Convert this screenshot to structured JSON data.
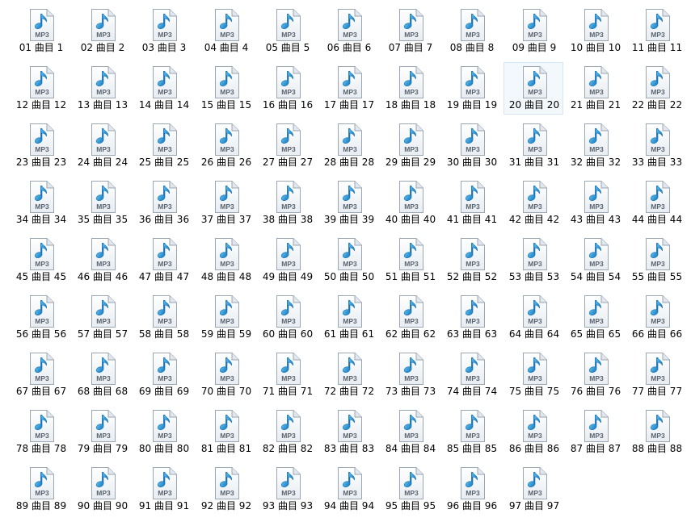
{
  "window": {
    "view": "large-icons",
    "selected_index": 19
  },
  "colors": {
    "page_bg": "#ffffff",
    "label_text": "#000000",
    "selection_bg": "#f3f8fd",
    "selection_border": "#d6e6f6",
    "note_color": "#1e86c8"
  },
  "file_icon": {
    "name": "mp3-file-icon",
    "badge_text": "MP3"
  },
  "files": [
    {
      "label": "01 曲目 1"
    },
    {
      "label": "02 曲目 2"
    },
    {
      "label": "03 曲目 3"
    },
    {
      "label": "04 曲目 4"
    },
    {
      "label": "05 曲目 5"
    },
    {
      "label": "06 曲目 6"
    },
    {
      "label": "07 曲目 7"
    },
    {
      "label": "08 曲目 8"
    },
    {
      "label": "09 曲目 9"
    },
    {
      "label": "10 曲目 10"
    },
    {
      "label": "11 曲目 11"
    },
    {
      "label": "12 曲目 12"
    },
    {
      "label": "13 曲目 13"
    },
    {
      "label": "14 曲目 14"
    },
    {
      "label": "15 曲目 15"
    },
    {
      "label": "16 曲目 16"
    },
    {
      "label": "17 曲目 17"
    },
    {
      "label": "18 曲目 18"
    },
    {
      "label": "19 曲目 19"
    },
    {
      "label": "20 曲目 20"
    },
    {
      "label": "21 曲目 21"
    },
    {
      "label": "22 曲目 22"
    },
    {
      "label": "23 曲目 23"
    },
    {
      "label": "24 曲目 24"
    },
    {
      "label": "25 曲目 25"
    },
    {
      "label": "26 曲目 26"
    },
    {
      "label": "27 曲目 27"
    },
    {
      "label": "28 曲目 28"
    },
    {
      "label": "29 曲目 29"
    },
    {
      "label": "30 曲目 30"
    },
    {
      "label": "31 曲目 31"
    },
    {
      "label": "32 曲目 32"
    },
    {
      "label": "33 曲目 33"
    },
    {
      "label": "34 曲目 34"
    },
    {
      "label": "35 曲目 35"
    },
    {
      "label": "36 曲目 36"
    },
    {
      "label": "37 曲目 37"
    },
    {
      "label": "38 曲目 38"
    },
    {
      "label": "39 曲目 39"
    },
    {
      "label": "40 曲目 40"
    },
    {
      "label": "41 曲目 41"
    },
    {
      "label": "42 曲目 42"
    },
    {
      "label": "43 曲目 43"
    },
    {
      "label": "44 曲目 44"
    },
    {
      "label": "45 曲目 45"
    },
    {
      "label": "46 曲目 46"
    },
    {
      "label": "47 曲目 47"
    },
    {
      "label": "48 曲目 48"
    },
    {
      "label": "49 曲目 49"
    },
    {
      "label": "50 曲目 50"
    },
    {
      "label": "51 曲目 51"
    },
    {
      "label": "52 曲目 52"
    },
    {
      "label": "53 曲目 53"
    },
    {
      "label": "54 曲目 54"
    },
    {
      "label": "55 曲目 55"
    },
    {
      "label": "56 曲目 56"
    },
    {
      "label": "57 曲目 57"
    },
    {
      "label": "58 曲目 58"
    },
    {
      "label": "59 曲目 59"
    },
    {
      "label": "60 曲目 60"
    },
    {
      "label": "61 曲目 61"
    },
    {
      "label": "62 曲目 62"
    },
    {
      "label": "63 曲目 63"
    },
    {
      "label": "64 曲目 64"
    },
    {
      "label": "65 曲目 65"
    },
    {
      "label": "66 曲目 66"
    },
    {
      "label": "67 曲目 67"
    },
    {
      "label": "68 曲目 68"
    },
    {
      "label": "69 曲目 69"
    },
    {
      "label": "70 曲目 70"
    },
    {
      "label": "71 曲目 71"
    },
    {
      "label": "72 曲目 72"
    },
    {
      "label": "73 曲目 73"
    },
    {
      "label": "74 曲目 74"
    },
    {
      "label": "75 曲目 75"
    },
    {
      "label": "76 曲目 76"
    },
    {
      "label": "77 曲目 77"
    },
    {
      "label": "78 曲目 78"
    },
    {
      "label": "79 曲目 79"
    },
    {
      "label": "80 曲目 80"
    },
    {
      "label": "81 曲目 81"
    },
    {
      "label": "82 曲目 82"
    },
    {
      "label": "83 曲目 83"
    },
    {
      "label": "84 曲目 84"
    },
    {
      "label": "85 曲目 85"
    },
    {
      "label": "86 曲目 86"
    },
    {
      "label": "87 曲目 87"
    },
    {
      "label": "88 曲目 88"
    },
    {
      "label": "89 曲目 89"
    },
    {
      "label": "90 曲目 90"
    },
    {
      "label": "91 曲目 91"
    },
    {
      "label": "92 曲目 92"
    },
    {
      "label": "93 曲目 93"
    },
    {
      "label": "94 曲目 94"
    },
    {
      "label": "95 曲目 95"
    },
    {
      "label": "96 曲目 96"
    },
    {
      "label": "97 曲目 97"
    }
  ]
}
